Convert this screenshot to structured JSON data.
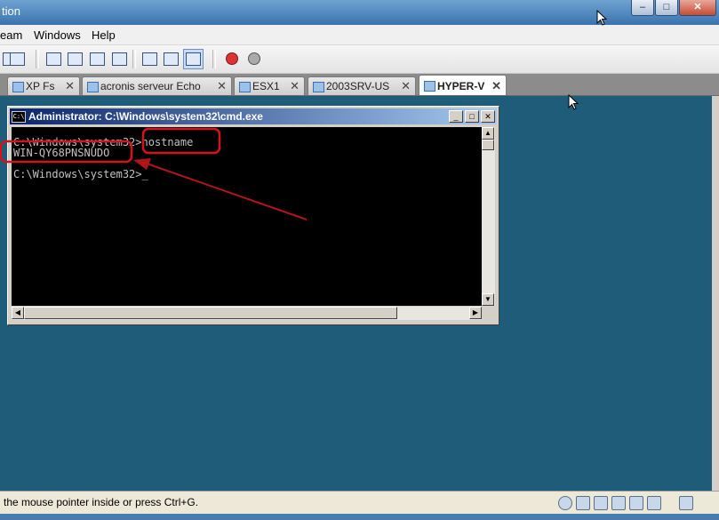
{
  "window": {
    "title": "tion",
    "controls": [
      "–",
      "□",
      "✕"
    ]
  },
  "menu": {
    "items": [
      "eam",
      "Windows",
      "Help"
    ]
  },
  "toolbar": {
    "icons": [
      "snapshot-icon",
      "toggle-sidebar-icon",
      "fullscreen-icon",
      "quick-switch-icon",
      "unity-icon",
      "console-view-icon",
      "power-on-icon",
      "vm-settings-icon",
      "full-console-icon",
      "record-icon",
      "replay-icon"
    ]
  },
  "tabs": [
    {
      "label": "XP Fs",
      "active": false
    },
    {
      "label": "acronis serveur Echo",
      "active": false
    },
    {
      "label": "ESX1",
      "active": false
    },
    {
      "label": "2003SRV-US",
      "active": false
    },
    {
      "label": "HYPER-V",
      "active": true
    }
  ],
  "tab_close_glyph": "✕",
  "cmd": {
    "title": "Administrator: C:\\Windows\\system32\\cmd.exe",
    "icon_text": "C:\\",
    "controls": [
      "_",
      "□",
      "✕"
    ],
    "line1_prompt": "C:\\Windows\\system32>",
    "line1_command": "hostname",
    "line2_output": "WIN-QY68PNSNUDO",
    "line3_prompt": "C:\\Windows\\system32>",
    "cursor": "_"
  },
  "status": {
    "text": "the mouse pointer inside or press Ctrl+G."
  },
  "colors": {
    "desktop": "#1f5c79",
    "annotation": "#d4141c",
    "console_bg": "#000000",
    "console_fg": "#c0c0c0"
  }
}
